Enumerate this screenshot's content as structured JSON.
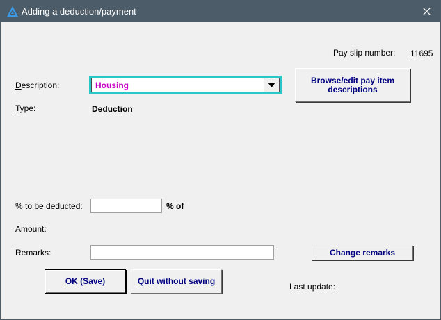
{
  "window": {
    "title": "Adding a deduction/payment"
  },
  "payslip": {
    "label": "Pay slip number:",
    "number": "11695"
  },
  "description": {
    "label": "Description:",
    "value": "Housing"
  },
  "type": {
    "label": "Type:",
    "value": "Deduction"
  },
  "buttons": {
    "browse_line1": "Browse/edit pay item",
    "browse_line2": "descriptions",
    "change_remarks": "Change remarks",
    "ok": "OK (Save)",
    "quit": "Quit without saving"
  },
  "percent": {
    "label": "% to be deducted:",
    "value": "",
    "suffix": "% of"
  },
  "amount": {
    "label": "Amount:"
  },
  "remarks": {
    "label": "Remarks:",
    "value": ""
  },
  "last_update": {
    "label": "Last update:"
  },
  "colors": {
    "titlebar": "#4c5c69",
    "combo_border": "#28c8c8",
    "combo_text": "#c800c8",
    "button_text": "#000080"
  }
}
